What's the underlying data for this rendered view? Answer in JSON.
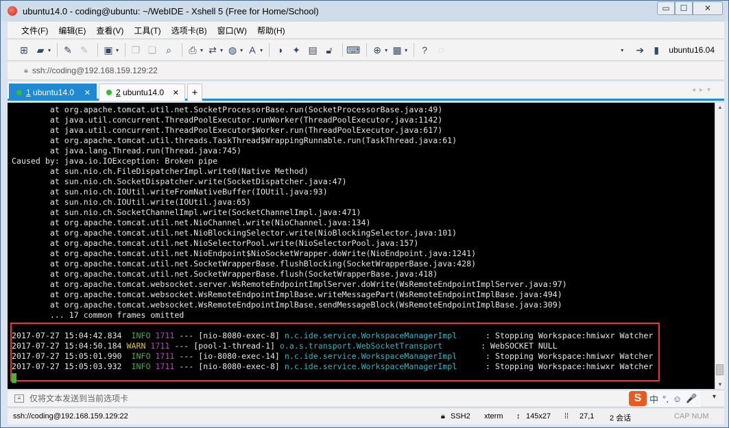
{
  "window": {
    "title": "ubuntu14.0 - coding@ubuntu: ~/WebIDE - Xshell 5 (Free for Home/School)",
    "controls": {
      "minimize": "▭",
      "maximize": "☐",
      "close": "✕"
    }
  },
  "menu": [
    "文件(F)",
    "编辑(E)",
    "查看(V)",
    "工具(T)",
    "选项卡(B)",
    "窗口(W)",
    "帮助(H)"
  ],
  "toolbar": {
    "right_label": "ubuntu16.04"
  },
  "address": {
    "text": "ssh://coding@192.168.159.129:22"
  },
  "tabs": [
    {
      "num": "1",
      "label": "ubuntu14.0",
      "close": "✕",
      "status_color": "#2ec02e"
    },
    {
      "num": "2",
      "label": "ubuntu14.0",
      "close": "✕",
      "status_color": "#2ec02e"
    }
  ],
  "tab_add": "+",
  "terminal": {
    "lines": [
      "        at org.apache.tomcat.util.net.SocketProcessorBase.run(SocketProcessorBase.java:49)",
      "        at java.util.concurrent.ThreadPoolExecutor.runWorker(ThreadPoolExecutor.java:1142)",
      "        at java.util.concurrent.ThreadPoolExecutor$Worker.run(ThreadPoolExecutor.java:617)",
      "        at org.apache.tomcat.util.threads.TaskThread$WrappingRunnable.run(TaskThread.java:61)",
      "        at java.lang.Thread.run(Thread.java:745)",
      "Caused by: java.io.IOException: Broken pipe",
      "        at sun.nio.ch.FileDispatcherImpl.write0(Native Method)",
      "        at sun.nio.ch.SocketDispatcher.write(SocketDispatcher.java:47)",
      "        at sun.nio.ch.IOUtil.writeFromNativeBuffer(IOUtil.java:93)",
      "        at sun.nio.ch.IOUtil.write(IOUtil.java:65)",
      "        at sun.nio.ch.SocketChannelImpl.write(SocketChannelImpl.java:471)",
      "        at org.apache.tomcat.util.net.NioChannel.write(NioChannel.java:134)",
      "        at org.apache.tomcat.util.net.NioBlockingSelector.write(NioBlockingSelector.java:101)",
      "        at org.apache.tomcat.util.net.NioSelectorPool.write(NioSelectorPool.java:157)",
      "        at org.apache.tomcat.util.net.NioEndpoint$NioSocketWrapper.doWrite(NioEndpoint.java:1241)",
      "        at org.apache.tomcat.util.net.SocketWrapperBase.flushBlocking(SocketWrapperBase.java:428)",
      "        at org.apache.tomcat.util.net.SocketWrapperBase.flush(SocketWrapperBase.java:418)",
      "        at org.apache.tomcat.websocket.server.WsRemoteEndpointImplServer.doWrite(WsRemoteEndpointImplServer.java:97)",
      "        at org.apache.tomcat.websocket.WsRemoteEndpointImplBase.writeMessagePart(WsRemoteEndpointImplBase.java:494)",
      "        at org.apache.tomcat.websocket.WsRemoteEndpointImplBase.sendMessageBlock(WsRemoteEndpointImplBase.java:309)",
      "        ... 17 common frames omitted"
    ],
    "log_entries": [
      {
        "ts": "2017-07-27 15:04:42.834",
        "level": "INFO",
        "pid": "1711",
        "sep": "---",
        "thread": "[nio-8080-exec-8]",
        "logger": "n.c.ide.service.WorkspaceManagerImpl     ",
        "msg": ": Stopping Workspace:hmiwxr Watcher"
      },
      {
        "ts": "2017-07-27 15:04:50.184",
        "level": "WARN",
        "pid": "1711",
        "sep": "---",
        "thread": "[pool-1-thread-1]",
        "logger": "o.a.s.transport.WebSocketTransport       ",
        "msg": ": WebSOCKET NULL"
      },
      {
        "ts": "2017-07-27 15:05:01.990",
        "level": "INFO",
        "pid": "1711",
        "sep": "---",
        "thread": "[io-8080-exec-14]",
        "logger": "n.c.ide.service.WorkspaceManagerImpl     ",
        "msg": ": Stopping Workspace:hmiwxr Watcher"
      },
      {
        "ts": "2017-07-27 15:05:03.932",
        "level": "INFO",
        "pid": "1711",
        "sep": "---",
        "thread": "[nio-8080-exec-8]",
        "logger": "n.c.ide.service.WorkspaceManagerImpl     ",
        "msg": ": Stopping Workspace:hmiwxr Watcher"
      }
    ]
  },
  "compose": {
    "placeholder": "仅将文本发送到当前选项卡"
  },
  "ime": {
    "logo": "S",
    "items": [
      "中",
      "°,",
      "☺",
      "🎤"
    ]
  },
  "status": {
    "connection": "ssh://coding@192.168.159.129:22",
    "protocol": "SSH2",
    "term": "xterm",
    "size": "145x27",
    "cursor": "27,1",
    "sessions": "2 会话",
    "caps": "CAP NUM"
  },
  "colors": {
    "accent": "#1f8ad2",
    "highlight_box": "#e23a3a",
    "info": "#3fae3f",
    "warn": "#e0c53a",
    "pid": "#b24ab2",
    "logger": "#2fb6c6"
  }
}
